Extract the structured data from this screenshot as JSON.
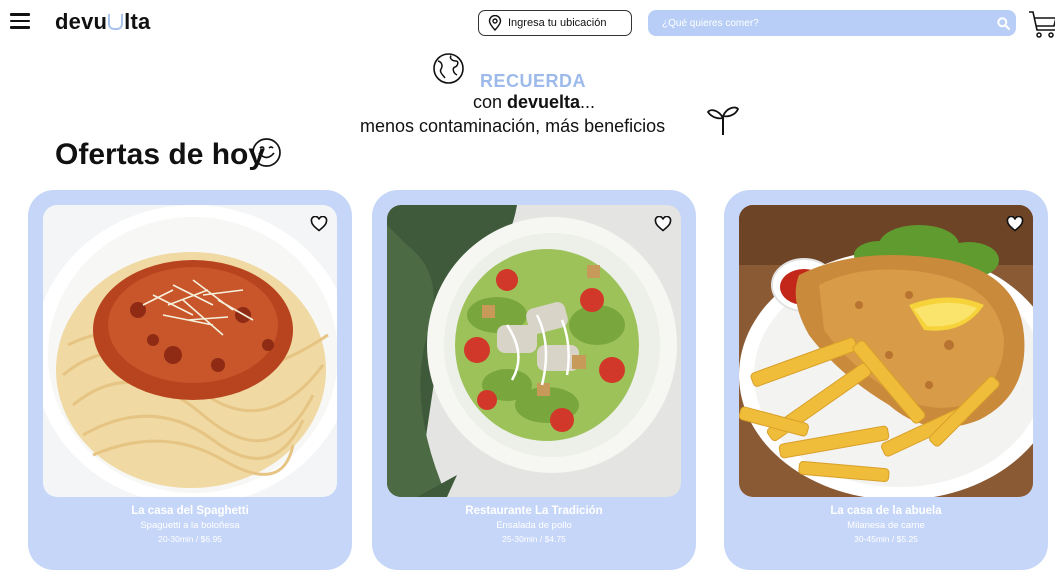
{
  "header": {
    "logo_text_before": "devu",
    "logo_text_after": "lta",
    "location_label": "Ingresa tu ubicación",
    "search_placeholder": "¿Qué quieres comer?"
  },
  "hero": {
    "recuerda": "RECUERDA",
    "line1_prefix": "con ",
    "line1_brand": "devuelta",
    "line1_suffix": "...",
    "line2": "menos contaminación, más beneficios"
  },
  "section": {
    "title": "Ofertas de hoy"
  },
  "colors": {
    "accent": "#b8cef6",
    "card_bg": "#c6d6f8",
    "brand_text": "#9dbaea"
  },
  "offers": [
    {
      "restaurant": "La casa del Spaghetti",
      "dish": "Spaguetti a la boloñesa",
      "time": "20-30min",
      "price": "$6.95",
      "image": "spaghetti-bolognese"
    },
    {
      "restaurant": "Restaurante La Tradición",
      "dish": "Ensalada de pollo",
      "time": "25-30min",
      "price": "$4.75",
      "image": "chicken-caesar-salad"
    },
    {
      "restaurant": "La casa de la abuela",
      "dish": "Milanesa de carne",
      "time": "30-45min",
      "price": "$5.25",
      "image": "milanesa-with-fries"
    }
  ]
}
